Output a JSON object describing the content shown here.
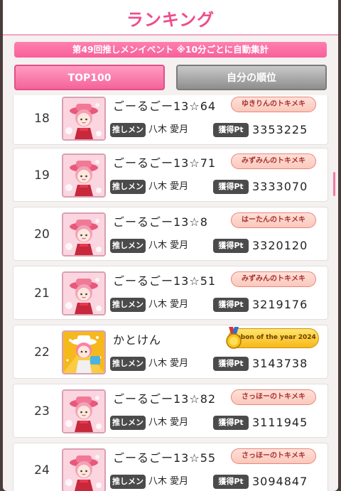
{
  "header": {
    "title": "ランキング"
  },
  "event_banner": "第49回推しメンイベント ※10分ごとに自動集計",
  "tabs": [
    {
      "label": "TOP100"
    },
    {
      "label": "自分の順位"
    }
  ],
  "labels": {
    "oshi": "推しメン",
    "points": "獲得Pt"
  },
  "rows": [
    {
      "rank": "18",
      "name": "ごーるごー13☆64",
      "badge": "ゆきりんのトキメキ",
      "member": "八木 愛月",
      "points": "3353225"
    },
    {
      "rank": "19",
      "name": "ごーるごー13☆71",
      "badge": "みずみんのトキメキ",
      "member": "八木 愛月",
      "points": "3333070"
    },
    {
      "rank": "20",
      "name": "ごーるごー13☆8",
      "badge": "はーたんのトキメキ",
      "member": "八木 愛月",
      "points": "3320120"
    },
    {
      "rank": "21",
      "name": "ごーるごー13☆51",
      "badge": "みずみんのトキメキ",
      "member": "八木 愛月",
      "points": "3219176"
    },
    {
      "rank": "22",
      "name": "かとけん",
      "badge": "Dobon of the year 2024",
      "member": "八木 愛月",
      "points": "3143738",
      "badge_style": "gold"
    },
    {
      "rank": "23",
      "name": "ごーるごー13☆82",
      "badge": "さっほーのトキメキ",
      "member": "八木 愛月",
      "points": "3111945"
    },
    {
      "rank": "24",
      "name": "ごーるごー13☆55",
      "badge": "さっほーのトキメキ",
      "member": "八木 愛月",
      "points": "3094847"
    }
  ],
  "colors": {
    "accent": "#f04a8c",
    "badge_text": "#a8322f",
    "pill": "#4b4b4b"
  }
}
